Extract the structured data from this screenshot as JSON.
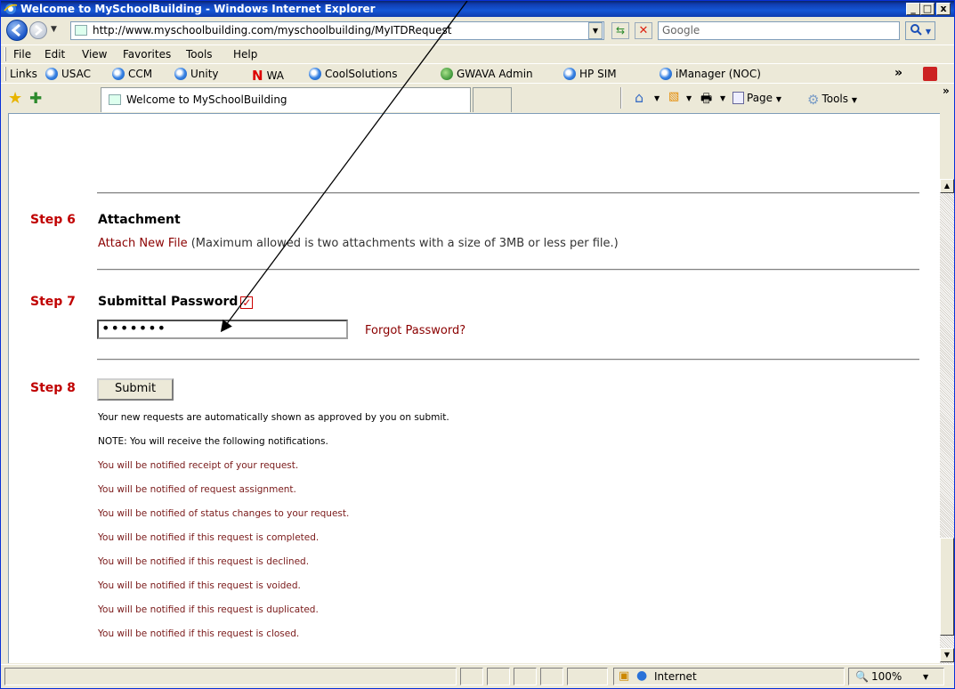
{
  "window": {
    "title": "Welcome to MySchoolBuilding - Windows Internet Explorer",
    "min_glyph": "_",
    "max_glyph": "□",
    "close_glyph": "x"
  },
  "address_bar": {
    "url": "http://www.myschoolbuilding.com/myschoolbuilding/MyITDRequest",
    "search_placeholder": "Google"
  },
  "menu": {
    "items": [
      "File",
      "Edit",
      "View",
      "Favorites",
      "Tools",
      "Help"
    ]
  },
  "links_bar": {
    "label": "Links",
    "items": [
      "USAC",
      "CCM",
      "Unity",
      "WA",
      "CoolSolutions",
      "GWAVA Admin",
      "HP SIM",
      "iManager (NOC)"
    ]
  },
  "tabs": {
    "active_label": "Welcome to MySchoolBuilding"
  },
  "command_bar": {
    "page_label": "Page",
    "tools_label": "Tools"
  },
  "form": {
    "step6": {
      "label": "Step 6",
      "title": "Attachment",
      "attach_link": "Attach New File",
      "attach_note": "(Maximum allowed is two attachments with a size of 3MB or less per file.)"
    },
    "step7": {
      "label": "Step 7",
      "title": "Submittal Password",
      "check_glyph": "✓",
      "password_value": "•••••••",
      "forgot_link": "Forgot Password?"
    },
    "step8": {
      "label": "Step 8",
      "submit_label": "Submit"
    },
    "notes": [
      "Your new requests are automatically shown as approved by you on submit.",
      "NOTE: You will receive the following notifications.",
      "You will be notified receipt of your request.",
      "You will be notified of request assignment.",
      "You will be notified of status changes to your request.",
      "You will be notified if this request is completed.",
      "You will be notified if this request is declined.",
      "You will be notified if this request is voided.",
      "You will be notified if this request is duplicated.",
      "You will be notified if this request is closed."
    ]
  },
  "status_bar": {
    "zone": "Internet",
    "zoom": "100%"
  },
  "colors": {
    "step_red": "#c00000",
    "link_dark_red": "#8B0000"
  }
}
